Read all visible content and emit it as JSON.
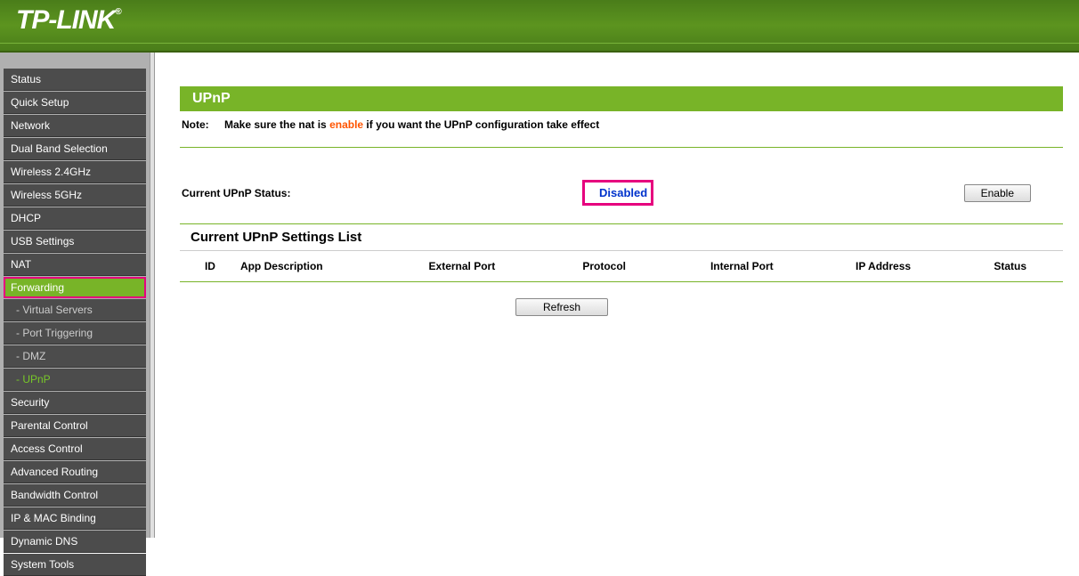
{
  "brand": "TP-LINK",
  "sidebar": {
    "items": [
      {
        "label": "Status"
      },
      {
        "label": "Quick Setup"
      },
      {
        "label": "Network"
      },
      {
        "label": "Dual Band Selection"
      },
      {
        "label": "Wireless 2.4GHz"
      },
      {
        "label": "Wireless 5GHz"
      },
      {
        "label": "DHCP"
      },
      {
        "label": "USB Settings"
      },
      {
        "label": "NAT"
      },
      {
        "label": "Forwarding",
        "selected": true
      },
      {
        "label": "- Virtual Servers",
        "sub": true
      },
      {
        "label": "- Port Triggering",
        "sub": true
      },
      {
        "label": "- DMZ",
        "sub": true
      },
      {
        "label": "- UPnP",
        "sub": true,
        "active": true
      },
      {
        "label": "Security"
      },
      {
        "label": "Parental Control"
      },
      {
        "label": "Access Control"
      },
      {
        "label": "Advanced Routing"
      },
      {
        "label": "Bandwidth Control"
      },
      {
        "label": "IP & MAC Binding"
      },
      {
        "label": "Dynamic DNS"
      },
      {
        "label": "System Tools"
      }
    ]
  },
  "page": {
    "title": "UPnP",
    "note_label": "Note:",
    "note_pre": "Make sure the nat is ",
    "note_highlight": "enable",
    "note_post": " if you want the UPnP configuration take effect",
    "status_label": "Current UPnP Status:",
    "status_value": "Disabled",
    "enable_button": "Enable",
    "list_title": "Current UPnP Settings List",
    "columns": {
      "id": "ID",
      "app": "App Description",
      "ext": "External Port",
      "proto": "Protocol",
      "int": "Internal Port",
      "ip": "IP Address",
      "status": "Status"
    },
    "refresh_button": "Refresh"
  }
}
